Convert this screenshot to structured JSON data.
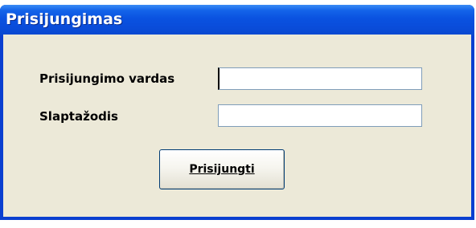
{
  "window": {
    "title": "Prisijungimas"
  },
  "form": {
    "username_label": "Prisijungimo vardas",
    "username_value": "",
    "password_label": "Slaptažodis",
    "password_value": "",
    "login_button_label": "Prisijungti"
  },
  "colors": {
    "titlebar": "#0a52e0",
    "client_background": "#ece9d8",
    "input_border": "#7f9db9"
  }
}
